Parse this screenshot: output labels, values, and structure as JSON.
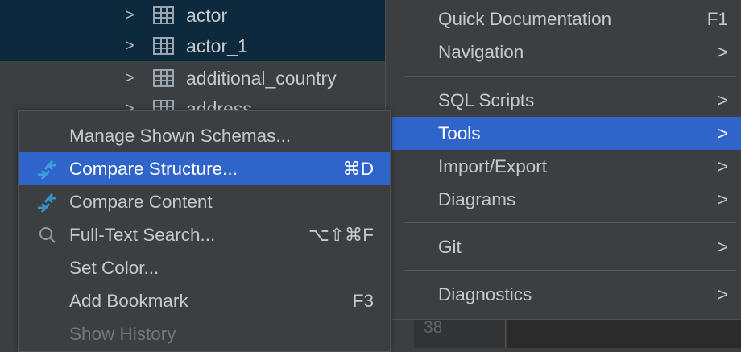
{
  "tree": {
    "items": [
      {
        "label": "actor",
        "selected": true
      },
      {
        "label": "actor_1",
        "selected": true
      },
      {
        "label": "additional_country",
        "selected": false
      },
      {
        "label": "address",
        "selected": false
      }
    ]
  },
  "context_menu": {
    "items": [
      {
        "label": "Quick Documentation",
        "shortcut": "F1"
      },
      {
        "label": "Navigation",
        "submenu": ">"
      },
      {
        "label": "SQL Scripts",
        "submenu": ">"
      },
      {
        "label": "Tools",
        "submenu": ">",
        "highlighted": true
      },
      {
        "label": "Import/Export",
        "submenu": ">"
      },
      {
        "label": "Diagrams",
        "submenu": ">"
      },
      {
        "label": "Git",
        "submenu": ">"
      },
      {
        "label": "Diagnostics",
        "submenu": ">"
      }
    ]
  },
  "tools_submenu": {
    "items": [
      {
        "label": "Manage Shown Schemas..."
      },
      {
        "label": "Compare Structure...",
        "shortcut": "⌘D",
        "icon": "compare-icon",
        "highlighted": true
      },
      {
        "label": "Compare Content",
        "icon": "compare-icon"
      },
      {
        "label": "Full-Text Search...",
        "shortcut": "⌥⇧⌘F",
        "icon": "search-icon"
      },
      {
        "label": "Set Color..."
      },
      {
        "label": "Add Bookmark",
        "shortcut": "F3"
      },
      {
        "label": "Show History",
        "disabled": true
      }
    ]
  },
  "editor": {
    "line_number": "38"
  },
  "colors": {
    "highlight": "#2f65ca",
    "selection": "#0d293e",
    "menu_bg": "#3c3f41",
    "icon_blue": "#3592c4"
  }
}
